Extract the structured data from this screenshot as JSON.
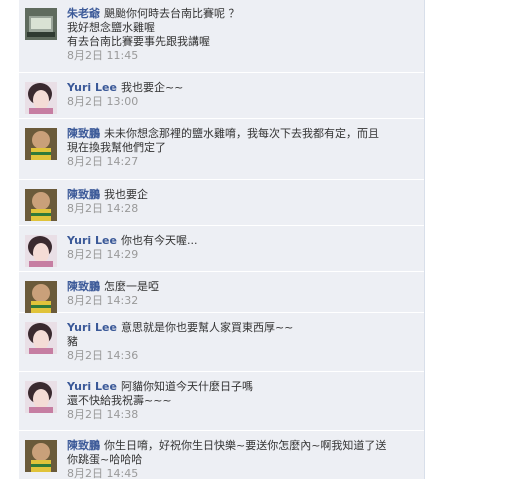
{
  "comments": [
    {
      "author": "朱老爺",
      "avatar": "avatar-laptop",
      "lines": [
        "颶颱你何時去台南比賽呢 ？",
        "我好想念鹽水雞喔",
        "有去台南比賽要事先跟我講喔"
      ],
      "time": "8月2日 11:45"
    },
    {
      "author": "Yuri Lee",
      "avatar": "avatar-girl",
      "lines": [
        "我也要企~~"
      ],
      "time": "8月2日 13:00"
    },
    {
      "author": "陳致鵬",
      "avatar": "avatar-boy",
      "lines": [
        "未未你想念那裡的鹽水雞唷，我每次下去我都有定，而且",
        "現在換我幫他們定了"
      ],
      "time": "8月2日 14:27"
    },
    {
      "author": "陳致鵬",
      "avatar": "avatar-boy",
      "lines": [
        "我也要企"
      ],
      "time": "8月2日 14:28"
    },
    {
      "author": "Yuri Lee",
      "avatar": "avatar-girl",
      "lines": [
        "你也有今天喔..."
      ],
      "time": "8月2日 14:29"
    },
    {
      "author": "陳致鵬",
      "avatar": "avatar-boy",
      "lines": [
        "怎麼一是啞"
      ],
      "time": "8月2日 14:32"
    },
    {
      "author": "Yuri Lee",
      "avatar": "avatar-girl",
      "lines": [
        "意思就是你也要幫人家買東西厚~~",
        "豬"
      ],
      "time": "8月2日 14:36"
    },
    {
      "author": "Yuri Lee",
      "avatar": "avatar-girl",
      "lines": [
        "阿貓你知道今天什麼日子嗎",
        "還不快給我祝壽~~~"
      ],
      "time": "8月2日 14:38"
    },
    {
      "author": "陳致鵬",
      "avatar": "avatar-boy",
      "lines": [
        "你生日唷，好祝你生日快樂~要送你怎麼內~啊我知道了送",
        "你跳蛋~哈哈哈"
      ],
      "time": "8月2日 14:45"
    }
  ]
}
